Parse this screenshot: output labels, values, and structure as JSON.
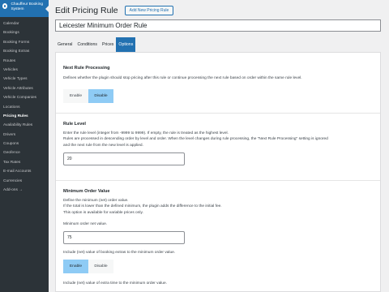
{
  "sidebar": {
    "brand": "Chauffeur Booking System",
    "items": [
      {
        "label": "Calendar"
      },
      {
        "label": "Bookings"
      },
      {
        "label": "Booking Forms"
      },
      {
        "label": "Booking Extras"
      },
      {
        "label": "Routes"
      },
      {
        "label": "Vehicles"
      },
      {
        "label": "Vehicle Types"
      },
      {
        "label": "Vehicle Attributes"
      },
      {
        "label": "Vehicle Companies"
      },
      {
        "label": "Locations"
      },
      {
        "label": "Pricing Rules"
      },
      {
        "label": "Availability Rules"
      },
      {
        "label": "Drivers"
      },
      {
        "label": "Coupons"
      },
      {
        "label": "Geofence"
      },
      {
        "label": "Tax Rates"
      },
      {
        "label": "E-mail Accounts"
      },
      {
        "label": "Currencies"
      },
      {
        "label": "Add-ons →"
      }
    ],
    "active_index": 10
  },
  "header": {
    "title": "Edit Pricing Rule",
    "add_button": "Add New Pricing Rule"
  },
  "rule_title": "Leicester Minimum Order Rule",
  "tabs": [
    "General",
    "Conditions",
    "Prices",
    "Options"
  ],
  "active_tab": "Options",
  "next_rule": {
    "title": "Next Rule Processing",
    "desc": "Defines whether the plugin should stop pricing after this rule or continue processing the next rule based on order within the same rule level.",
    "enable": "Enable",
    "disable": "Disable",
    "selected": "Disable"
  },
  "rule_level": {
    "title": "Rule Level",
    "desc1": "Enter the rule level (integer from -9999 to 9999). If empty, the rule is treated as the highest level.",
    "desc2": "Rules are processed in descending order by level and order. When the level changes during rule processing, the \"Next Rule Processing\" setting is ignored",
    "desc3": "and the next rule from the new level is applied.",
    "value": "20"
  },
  "min_order": {
    "title": "Minimum Order Value",
    "desc1": "Define the minimum (net) order value.",
    "desc2": "If the total is lower than the defined minimum, the plugin adds the difference to the initial fee.",
    "desc3": "This option is available for variable prices only.",
    "net_label": "Minimum order net value.",
    "net_value": "75",
    "extras_label": "Include (net) value of booking extras to the minimum order value.",
    "enable": "Enable",
    "disable": "Disable",
    "selected": "Enable",
    "extra_time_label": "Include (net) value of extra time to the minimum order value."
  }
}
